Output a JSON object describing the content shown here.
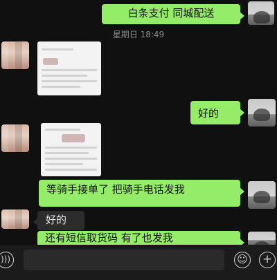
{
  "timestamp": "星期日 18:49",
  "messages": {
    "m1": "白条支付 同城配送",
    "m2": "好的",
    "m3": "等骑手接单了 把骑手电话发我",
    "m4": "好的",
    "m5": "还有短信取货码 有了也发我"
  },
  "input": {
    "placeholder": ""
  },
  "icons": {
    "voice": "voice-icon",
    "emoji": "emoji-icon",
    "more": "plus-icon"
  },
  "colors": {
    "outgoing_bubble": "#95ec69",
    "incoming_bubble": "#2c2c2c",
    "background": "#101010"
  }
}
